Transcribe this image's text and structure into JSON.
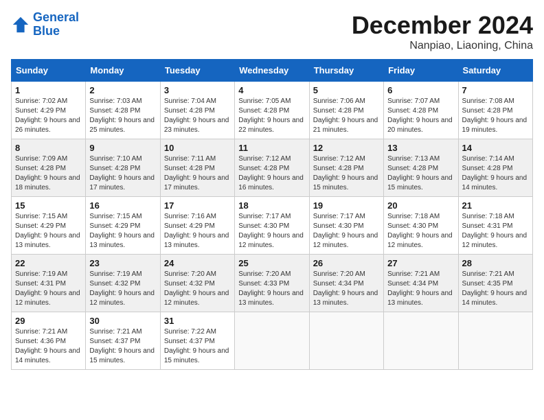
{
  "header": {
    "logo_line1": "General",
    "logo_line2": "Blue",
    "month_title": "December 2024",
    "location": "Nanpiao, Liaoning, China"
  },
  "days_of_week": [
    "Sunday",
    "Monday",
    "Tuesday",
    "Wednesday",
    "Thursday",
    "Friday",
    "Saturday"
  ],
  "weeks": [
    [
      {
        "day": "1",
        "sunrise": "7:02 AM",
        "sunset": "4:29 PM",
        "daylight": "9 hours and 26 minutes."
      },
      {
        "day": "2",
        "sunrise": "7:03 AM",
        "sunset": "4:28 PM",
        "daylight": "9 hours and 25 minutes."
      },
      {
        "day": "3",
        "sunrise": "7:04 AM",
        "sunset": "4:28 PM",
        "daylight": "9 hours and 23 minutes."
      },
      {
        "day": "4",
        "sunrise": "7:05 AM",
        "sunset": "4:28 PM",
        "daylight": "9 hours and 22 minutes."
      },
      {
        "day": "5",
        "sunrise": "7:06 AM",
        "sunset": "4:28 PM",
        "daylight": "9 hours and 21 minutes."
      },
      {
        "day": "6",
        "sunrise": "7:07 AM",
        "sunset": "4:28 PM",
        "daylight": "9 hours and 20 minutes."
      },
      {
        "day": "7",
        "sunrise": "7:08 AM",
        "sunset": "4:28 PM",
        "daylight": "9 hours and 19 minutes."
      }
    ],
    [
      {
        "day": "8",
        "sunrise": "7:09 AM",
        "sunset": "4:28 PM",
        "daylight": "9 hours and 18 minutes."
      },
      {
        "day": "9",
        "sunrise": "7:10 AM",
        "sunset": "4:28 PM",
        "daylight": "9 hours and 17 minutes."
      },
      {
        "day": "10",
        "sunrise": "7:11 AM",
        "sunset": "4:28 PM",
        "daylight": "9 hours and 17 minutes."
      },
      {
        "day": "11",
        "sunrise": "7:12 AM",
        "sunset": "4:28 PM",
        "daylight": "9 hours and 16 minutes."
      },
      {
        "day": "12",
        "sunrise": "7:12 AM",
        "sunset": "4:28 PM",
        "daylight": "9 hours and 15 minutes."
      },
      {
        "day": "13",
        "sunrise": "7:13 AM",
        "sunset": "4:28 PM",
        "daylight": "9 hours and 15 minutes."
      },
      {
        "day": "14",
        "sunrise": "7:14 AM",
        "sunset": "4:28 PM",
        "daylight": "9 hours and 14 minutes."
      }
    ],
    [
      {
        "day": "15",
        "sunrise": "7:15 AM",
        "sunset": "4:29 PM",
        "daylight": "9 hours and 13 minutes."
      },
      {
        "day": "16",
        "sunrise": "7:15 AM",
        "sunset": "4:29 PM",
        "daylight": "9 hours and 13 minutes."
      },
      {
        "day": "17",
        "sunrise": "7:16 AM",
        "sunset": "4:29 PM",
        "daylight": "9 hours and 13 minutes."
      },
      {
        "day": "18",
        "sunrise": "7:17 AM",
        "sunset": "4:30 PM",
        "daylight": "9 hours and 12 minutes."
      },
      {
        "day": "19",
        "sunrise": "7:17 AM",
        "sunset": "4:30 PM",
        "daylight": "9 hours and 12 minutes."
      },
      {
        "day": "20",
        "sunrise": "7:18 AM",
        "sunset": "4:30 PM",
        "daylight": "9 hours and 12 minutes."
      },
      {
        "day": "21",
        "sunrise": "7:18 AM",
        "sunset": "4:31 PM",
        "daylight": "9 hours and 12 minutes."
      }
    ],
    [
      {
        "day": "22",
        "sunrise": "7:19 AM",
        "sunset": "4:31 PM",
        "daylight": "9 hours and 12 minutes."
      },
      {
        "day": "23",
        "sunrise": "7:19 AM",
        "sunset": "4:32 PM",
        "daylight": "9 hours and 12 minutes."
      },
      {
        "day": "24",
        "sunrise": "7:20 AM",
        "sunset": "4:32 PM",
        "daylight": "9 hours and 12 minutes."
      },
      {
        "day": "25",
        "sunrise": "7:20 AM",
        "sunset": "4:33 PM",
        "daylight": "9 hours and 13 minutes."
      },
      {
        "day": "26",
        "sunrise": "7:20 AM",
        "sunset": "4:34 PM",
        "daylight": "9 hours and 13 minutes."
      },
      {
        "day": "27",
        "sunrise": "7:21 AM",
        "sunset": "4:34 PM",
        "daylight": "9 hours and 13 minutes."
      },
      {
        "day": "28",
        "sunrise": "7:21 AM",
        "sunset": "4:35 PM",
        "daylight": "9 hours and 14 minutes."
      }
    ],
    [
      {
        "day": "29",
        "sunrise": "7:21 AM",
        "sunset": "4:36 PM",
        "daylight": "9 hours and 14 minutes."
      },
      {
        "day": "30",
        "sunrise": "7:21 AM",
        "sunset": "4:37 PM",
        "daylight": "9 hours and 15 minutes."
      },
      {
        "day": "31",
        "sunrise": "7:22 AM",
        "sunset": "4:37 PM",
        "daylight": "9 hours and 15 minutes."
      },
      null,
      null,
      null,
      null
    ]
  ],
  "labels": {
    "sunrise": "Sunrise:",
    "sunset": "Sunset:",
    "daylight": "Daylight:"
  }
}
